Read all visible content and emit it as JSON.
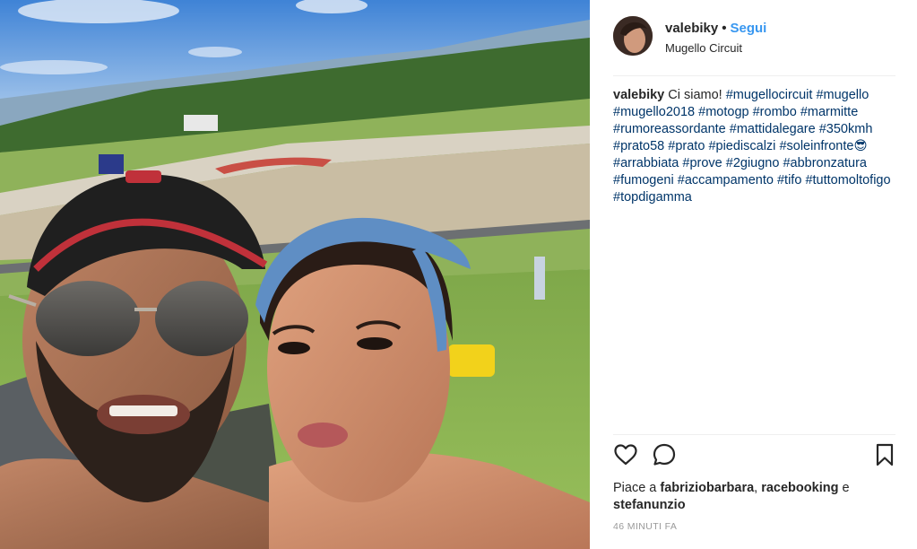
{
  "post": {
    "username": "valebiky",
    "dot": "•",
    "follow_label": "Segui",
    "location": "Mugello Circuit"
  },
  "caption": {
    "username": "valebiky",
    "text": "Ci siamo!",
    "hashtags": [
      "#mugellocircuit",
      "#mugello",
      "#mugello2018",
      "#motogp",
      "#rombo",
      "#marmitte",
      "#rumoreassordante",
      "#mattidalegare",
      "#350kmh",
      "#prato58",
      "#prato",
      "#piediscalzi",
      "#soleinfronte😎",
      "#arrabbiata",
      "#prove",
      "#2giugno",
      "#abbronzatura",
      "#fumogeni",
      "#accampamento",
      "#tifo",
      "#tuttomoltofigo",
      "#topdigamma"
    ]
  },
  "actions": {
    "like_icon": "heart-icon",
    "comment_icon": "comment-bubble-icon",
    "save_icon": "bookmark-icon"
  },
  "likes": {
    "prefix": "Piace a",
    "user1": "fabriziobarbara",
    "sep": ",",
    "user2": "racebooking",
    "conj": "e",
    "user3": "stefanunzio"
  },
  "timestamp": "46 MINUTI FA",
  "colors": {
    "link_blue": "#3897f0",
    "hashtag": "#003569",
    "text": "#262626",
    "muted": "#999999",
    "divider": "#efefef"
  }
}
